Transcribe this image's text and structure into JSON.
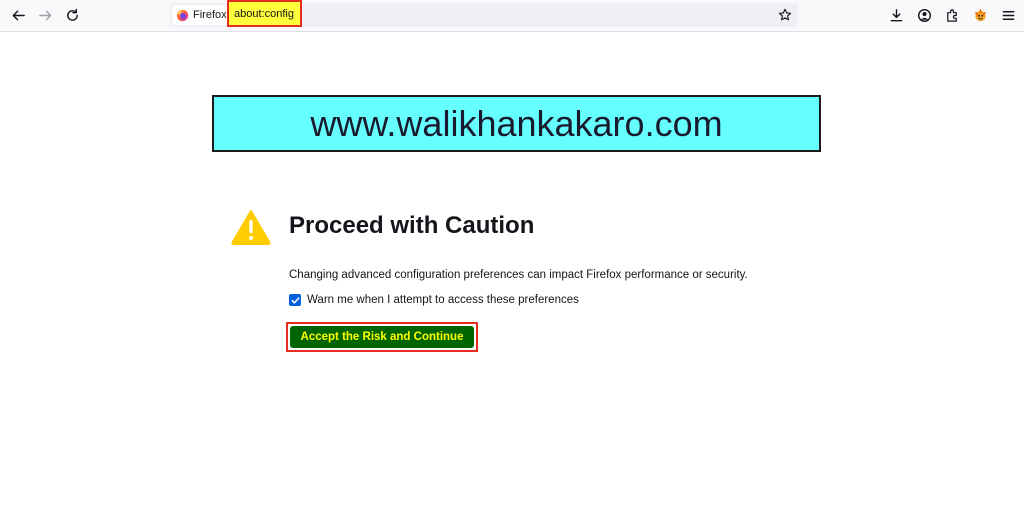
{
  "browser": {
    "identity_label": "Firefox",
    "url": "about:config"
  },
  "icons": {
    "back": "back-arrow-icon",
    "forward": "forward-arrow-icon",
    "reload": "reload-icon",
    "bookmark": "star-icon",
    "downloads": "download-icon",
    "account": "account-icon",
    "extensions": "extensions-icon",
    "profile": "profile-extension-icon",
    "menu": "hamburger-menu-icon",
    "warning": "warning-triangle-icon"
  },
  "banner": {
    "text": "www.walikhankakaro.com",
    "bg_color": "#66ffff"
  },
  "warning_page": {
    "title": "Proceed with Caution",
    "description": "Changing advanced configuration preferences can impact Firefox performance or security.",
    "checkbox_label": "Warn me when I attempt to access these preferences",
    "checkbox_checked": true,
    "accept_button": "Accept the Risk and Continue",
    "accept_button_bg": "#006400",
    "accept_button_text_color": "#ffff00",
    "highlight_color": "#e22d1f"
  }
}
